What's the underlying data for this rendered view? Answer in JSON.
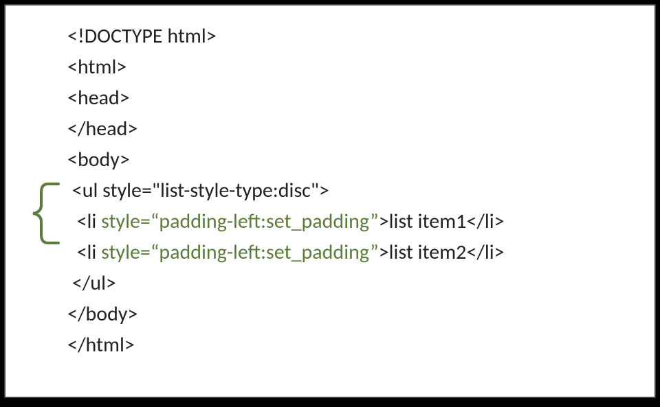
{
  "code": {
    "l1": "<!DOCTYPE html>",
    "l2": "<html>",
    "l3": "<head>",
    "l4": "</head>",
    "l5": "<body>",
    "l6": " <ul style=\"list-style-type:disc\">",
    "l7a": "  <li ",
    "l7b": "style=“padding-left:set_padding”",
    "l7c": ">list item1</li>",
    "l8a": "  <li ",
    "l8b": "style=“padding-left:set_padding”",
    "l8c": ">list item2</li>",
    "l9": " </ul>",
    "l10": "</body>",
    "l11": "</html>"
  }
}
